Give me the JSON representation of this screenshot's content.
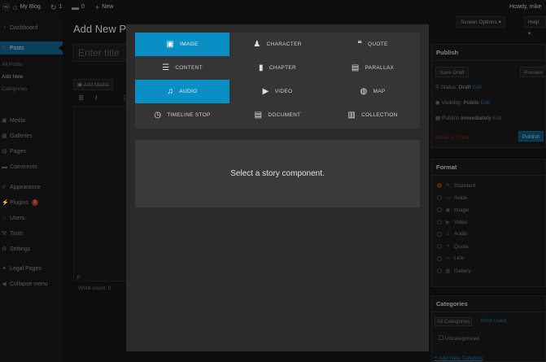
{
  "adminbar": {
    "site_name": "My Blog",
    "updates_count": "1",
    "comments_count": "0",
    "new_label": "New",
    "howdy": "Howdy, mike"
  },
  "sidebar": {
    "items": [
      {
        "label": "Dashboard",
        "icon": "dashboard-icon"
      },
      {
        "label": "Posts",
        "icon": "pin-icon"
      },
      {
        "label": "Media",
        "icon": "media-icon"
      },
      {
        "label": "Galleries",
        "icon": "gallery-icon"
      },
      {
        "label": "Pages",
        "icon": "pages-icon"
      },
      {
        "label": "Comments",
        "icon": "comment-icon"
      },
      {
        "label": "Appearance",
        "icon": "brush-icon"
      },
      {
        "label": "Plugins",
        "icon": "plug-icon",
        "badge": "2"
      },
      {
        "label": "Users",
        "icon": "users-icon"
      },
      {
        "label": "Tools",
        "icon": "wrench-icon"
      },
      {
        "label": "Settings",
        "icon": "settings-icon"
      },
      {
        "label": "Legal Pages",
        "icon": "legal-icon"
      },
      {
        "label": "Collapse menu",
        "icon": "collapse-icon"
      }
    ],
    "posts_submenu": [
      "All Posts",
      "Add New",
      "Categories"
    ]
  },
  "main": {
    "page_title": "Add New P",
    "screen_options": "Screen Options ▾",
    "help": "Help ▾",
    "title_placeholder": "Enter title",
    "add_media": "Add Media",
    "format_bold": "B",
    "format_italic": "I",
    "format_more": "⋮",
    "editor_path": "p",
    "word_count": "Word count: 0"
  },
  "publish": {
    "heading": "Publish",
    "save_draft": "Save Draft",
    "preview": "Preview",
    "status_label": "Status:",
    "status_value": "Draft",
    "visibility_label": "Visibility:",
    "visibility_value": "Public",
    "publish_label": "Publish",
    "publish_value": "immediately",
    "edit": "Edit",
    "trash": "Move to Trash",
    "publish_button": "Publish"
  },
  "format_box": {
    "heading": "Format",
    "options": [
      {
        "label": "Standard",
        "icon": "pin-icon",
        "checked": true
      },
      {
        "label": "Aside",
        "icon": "aside-icon",
        "checked": false
      },
      {
        "label": "Image",
        "icon": "image-icon",
        "checked": false
      },
      {
        "label": "Video",
        "icon": "video-icon",
        "checked": false
      },
      {
        "label": "Audio",
        "icon": "audio-icon",
        "checked": false
      },
      {
        "label": "Quote",
        "icon": "quote-icon",
        "checked": false
      },
      {
        "label": "Link",
        "icon": "link-icon",
        "checked": false
      },
      {
        "label": "Gallery",
        "icon": "gallery-icon",
        "checked": false
      }
    ]
  },
  "categories_box": {
    "heading": "Categories",
    "tab_all": "All Categories",
    "tab_most_used": "Most Used",
    "items": [
      "Uncategorized"
    ],
    "add_new": "+ Add New Category"
  },
  "modal": {
    "components": [
      {
        "label": "IMAGE",
        "icon": "image-icon",
        "selected": true
      },
      {
        "label": "CHARACTER",
        "icon": "character-icon",
        "selected": false
      },
      {
        "label": "QUOTE",
        "icon": "quote-icon",
        "selected": false
      },
      {
        "label": "CONTENT",
        "icon": "content-icon",
        "selected": false
      },
      {
        "label": "CHAPTER",
        "icon": "chapter-icon",
        "selected": false
      },
      {
        "label": "PARALLAX",
        "icon": "parallax-icon",
        "selected": false
      },
      {
        "label": "AUDIO",
        "icon": "audio-icon",
        "selected": true
      },
      {
        "label": "VIDEO",
        "icon": "video-icon",
        "selected": false
      },
      {
        "label": "MAP",
        "icon": "globe-icon",
        "selected": false
      },
      {
        "label": "TIMELINE STOP",
        "icon": "clock-icon",
        "selected": false
      },
      {
        "label": "DOCUMENT",
        "icon": "document-icon",
        "selected": false
      },
      {
        "label": "COLLECTION",
        "icon": "collection-icon",
        "selected": false
      }
    ],
    "empty_message": "Select a story component."
  },
  "colors": {
    "accent": "#0a8fc5",
    "modal_bg": "#2b2b2b",
    "grid_bg": "#353535"
  }
}
